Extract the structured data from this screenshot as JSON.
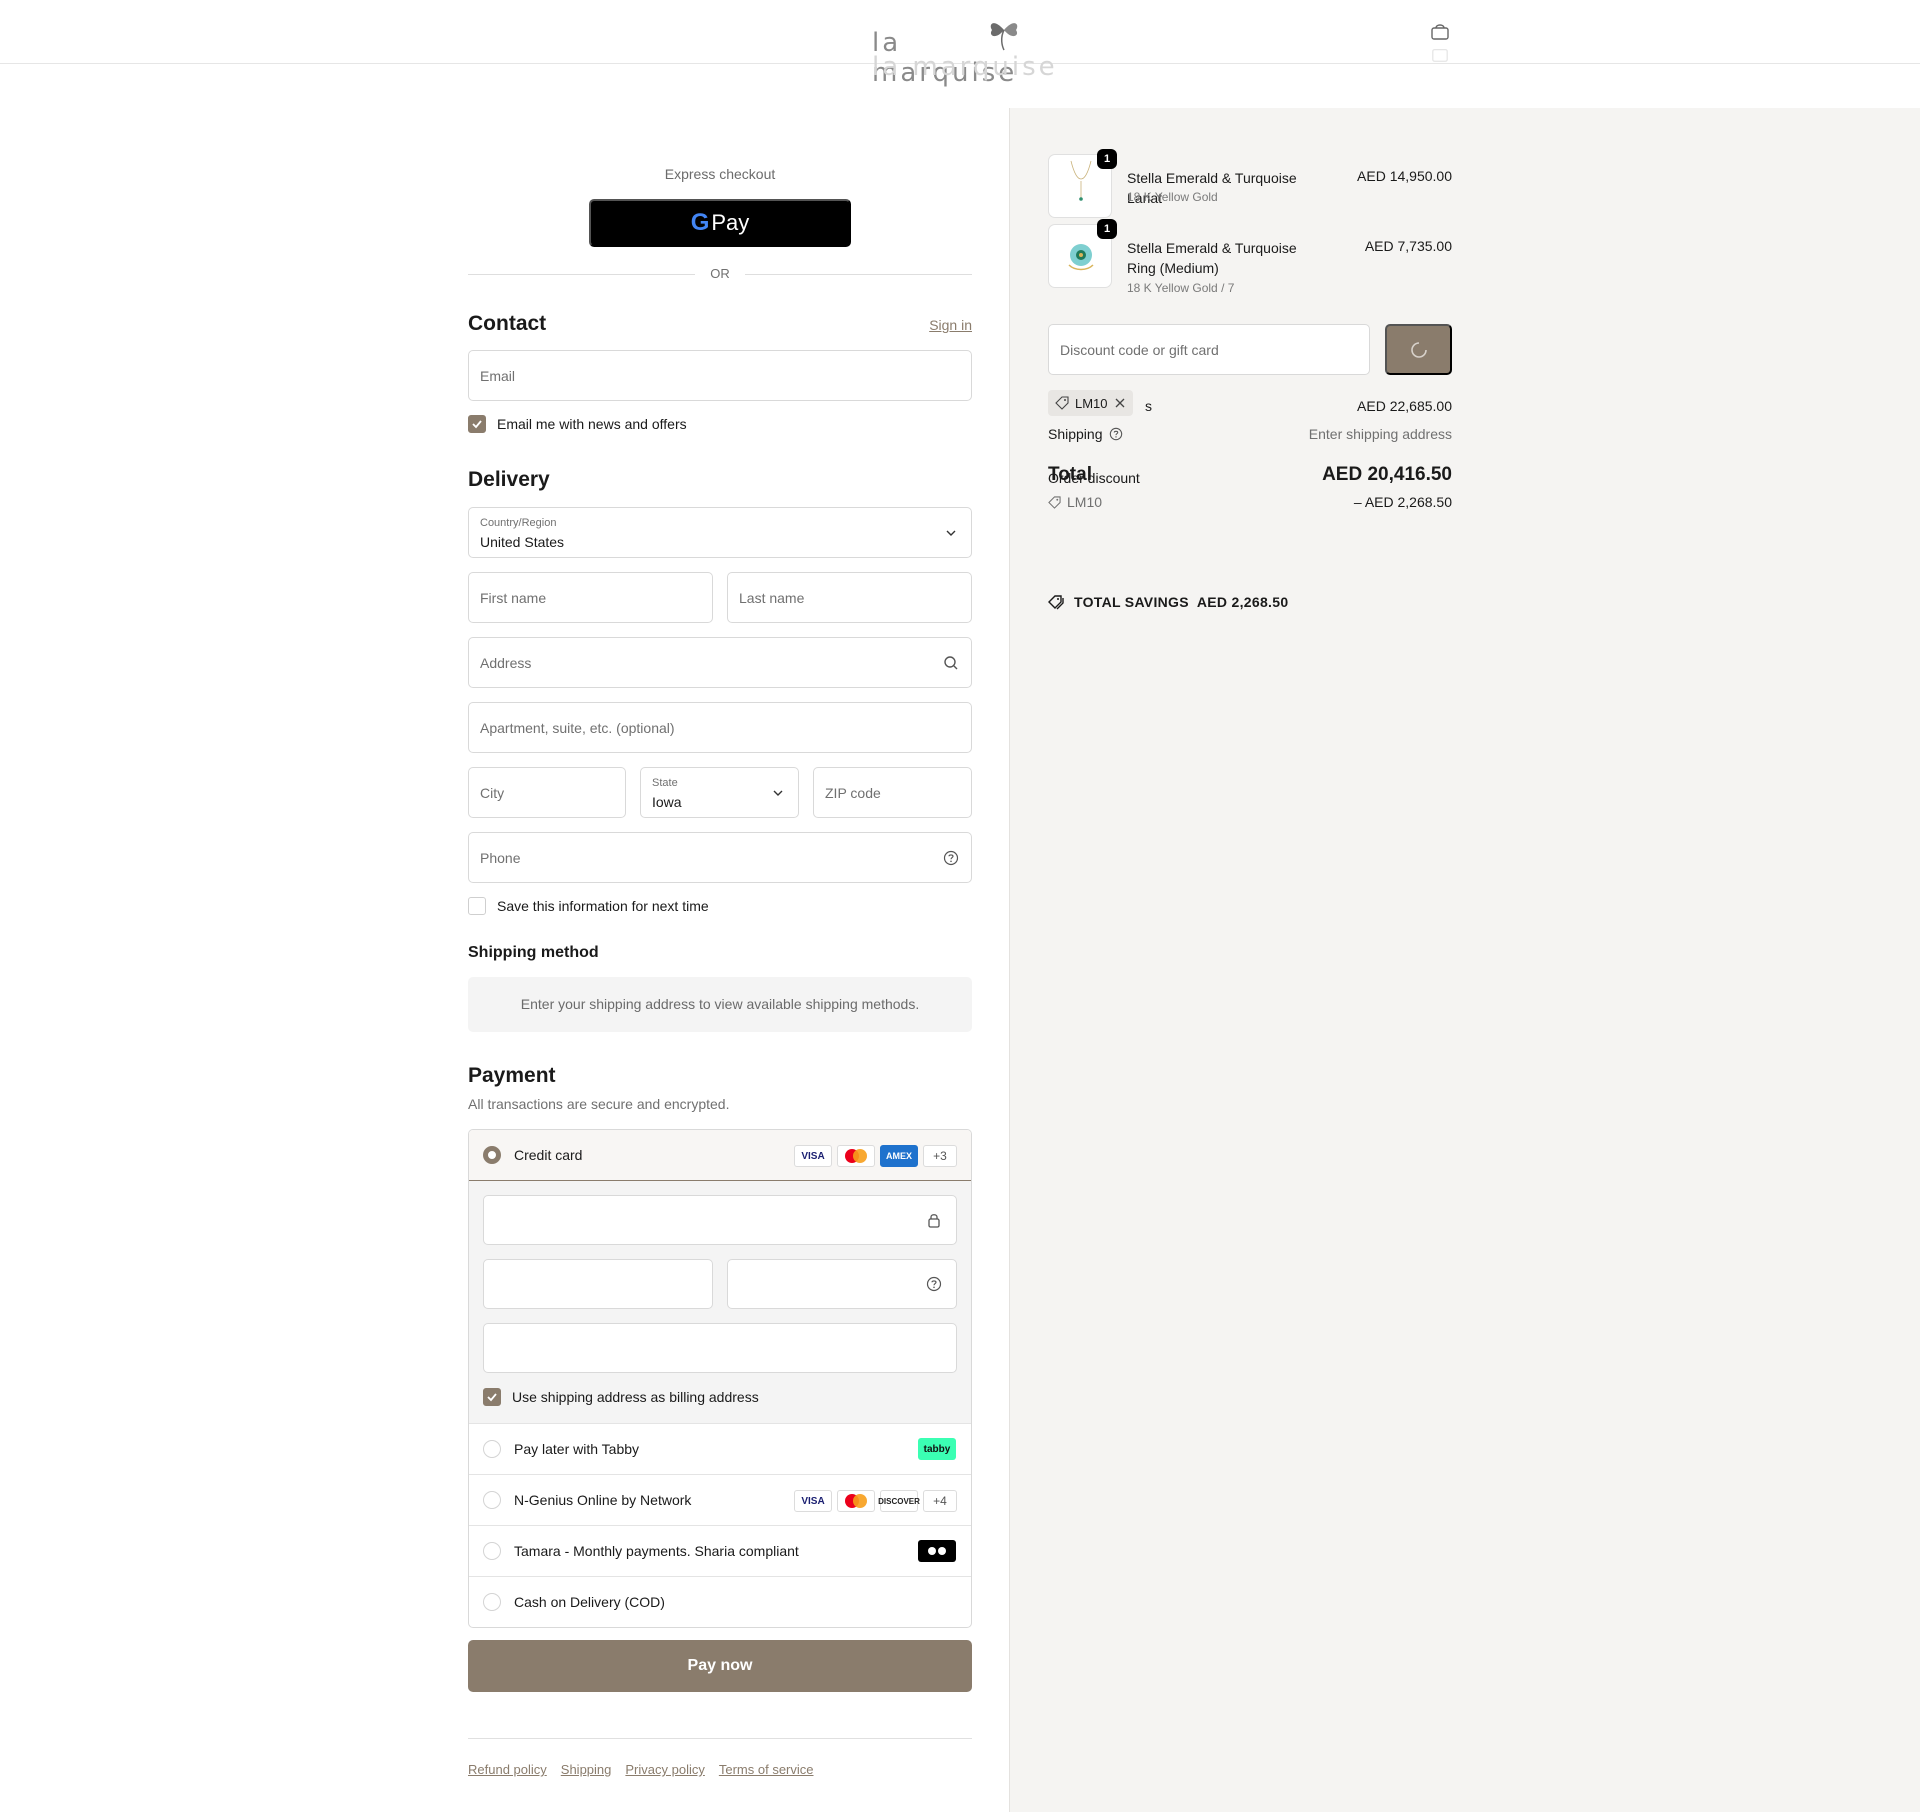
{
  "brand": {
    "name": "la marquise"
  },
  "header": {
    "cart_icon": "bag-icon"
  },
  "express": {
    "label": "Express checkout",
    "gpay_label": "Pay",
    "or": "OR"
  },
  "contact": {
    "title": "Contact",
    "sign_in": "Sign in",
    "email_placeholder": "Email",
    "news_label": "Email me with news and offers",
    "news_checked": true
  },
  "delivery": {
    "title": "Delivery",
    "country_label": "Country/Region",
    "country_value": "United States",
    "first_name": "First name",
    "last_name": "Last name",
    "address": "Address",
    "apartment": "Apartment, suite, etc. (optional)",
    "city": "City",
    "state_label": "State",
    "state_value": "Iowa",
    "zip": "ZIP code",
    "phone": "Phone",
    "save_info": "Save this information for next time"
  },
  "shipping_method": {
    "title": "Shipping method",
    "message": "Enter your shipping address to view available shipping methods."
  },
  "payment": {
    "title": "Payment",
    "subtitle": "All transactions are secure and encrypted.",
    "options": [
      {
        "label": "Credit card",
        "selected": true,
        "more": "+3"
      },
      {
        "label": "Pay later with Tabby",
        "badge": "tabby"
      },
      {
        "label": "N-Genius Online by Network",
        "more": "+4"
      },
      {
        "label": "Tamara - Monthly payments. Sharia compliant"
      },
      {
        "label": "Cash on Delivery (COD)"
      }
    ],
    "billing_label": "Use shipping address as billing address",
    "pay_now": "Pay now",
    "logos": {
      "visa": "VISA",
      "amex": "AMEX",
      "discover": "DISCOVER"
    }
  },
  "footer": {
    "links": [
      "Refund policy",
      "Shipping",
      "Privacy policy",
      "Terms of service"
    ]
  },
  "summary": {
    "items": [
      {
        "qty": "1",
        "name": "Stella Emerald & Turquoise Lariat",
        "variant": "18 K Yellow Gold",
        "price": "AED 14,950.00"
      },
      {
        "qty": "1",
        "name": "Stella Emerald & Turquoise Ring (Medium)",
        "variant": "18 K Yellow Gold / 7",
        "price": "AED 7,735.00"
      }
    ],
    "discount_placeholder": "Discount code or gift card",
    "code_chip": "LM10",
    "subtotal_suffix": "s",
    "subtotal_value": "AED 22,685.00",
    "shipping_label": "Shipping",
    "shipping_value": "Enter shipping address",
    "total_label": "Total",
    "total_overlap_label": "Order discount",
    "total_value": "AED 20,416.50",
    "discount_code": "LM10",
    "discount_value": "– AED 2,268.50",
    "savings_label": "TOTAL SAVINGS",
    "savings_value": "AED 2,268.50"
  },
  "colors": {
    "accent": "#8a7c6c",
    "summary_bg": "#f5f4f2"
  }
}
